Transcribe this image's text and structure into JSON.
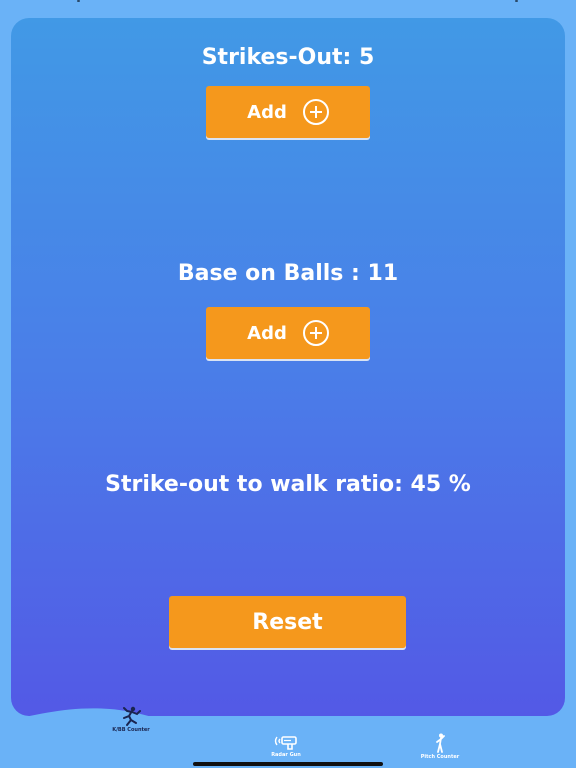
{
  "strikeouts": {
    "title": "Strikes-Out: 5",
    "add_label": "Add"
  },
  "walks": {
    "title": "Base on Balls : 11",
    "add_label": "Add"
  },
  "ratio": {
    "text": "Strike-out to walk ratio: 45 %"
  },
  "reset_label": "Reset",
  "tab_bar": {
    "items": [
      {
        "label": "K/BB Counter",
        "icon": "pitcher-icon",
        "selected": true
      },
      {
        "label": "Radar Gun",
        "icon": "radar-gun-icon",
        "selected": false
      },
      {
        "label": "Pitch Counter",
        "icon": "pitch-counter-icon",
        "selected": false
      }
    ]
  },
  "colors": {
    "background": "#6ab2f7",
    "card_top": "#4199e6",
    "card_bottom": "#5359e6",
    "button": "#f5981c",
    "text": "#ffffff",
    "tab_selected": "#1a2550",
    "tab_unselected": "#ffffff"
  }
}
